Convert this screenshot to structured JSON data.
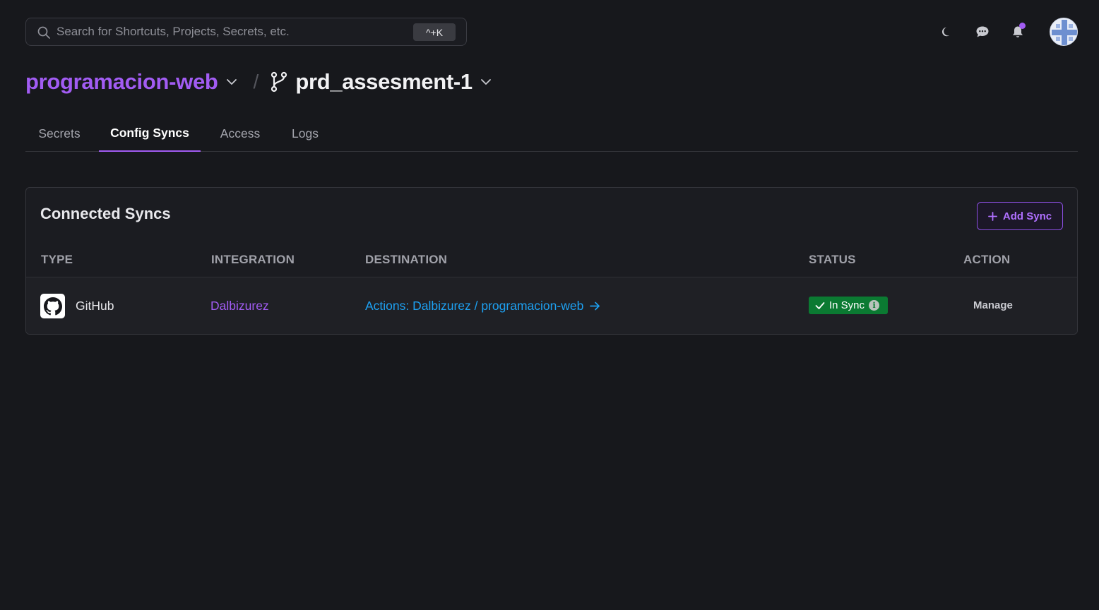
{
  "search": {
    "placeholder": "Search for Shortcuts, Projects, Secrets, etc.",
    "shortcut": "^+K"
  },
  "header_icons": [
    "moon-icon",
    "chat-icon",
    "bell-icon",
    "avatar"
  ],
  "breadcrumb": {
    "project": "programacion-web",
    "separator": "/",
    "environment": "prd_assesment-1"
  },
  "tabs": [
    {
      "label": "Secrets",
      "active": false
    },
    {
      "label": "Config Syncs",
      "active": true
    },
    {
      "label": "Access",
      "active": false
    },
    {
      "label": "Logs",
      "active": false
    }
  ],
  "syncs": {
    "title": "Connected Syncs",
    "add_button": "Add Sync",
    "columns": {
      "type": "TYPE",
      "integration": "INTEGRATION",
      "destination": "DESTINATION",
      "status": "STATUS",
      "action": "ACTION"
    },
    "rows": [
      {
        "type": "GitHub",
        "integration": "Dalbizurez",
        "destination": "Actions: Dalbizurez / programacion-web",
        "status": "In Sync",
        "action": "Manage"
      }
    ]
  },
  "colors": {
    "background": "#17181c",
    "accent_purple": "#a25cf3",
    "link_blue": "#1da1f2",
    "status_green": "#0b7a32"
  }
}
